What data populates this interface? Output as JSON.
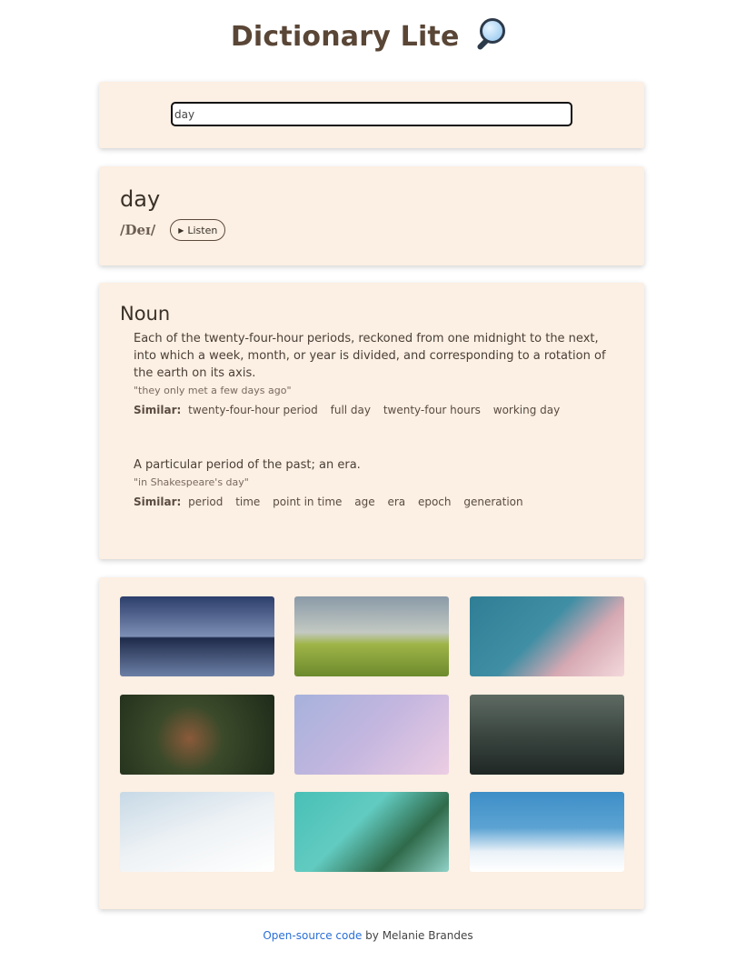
{
  "app": {
    "title": "Dictionary Lite"
  },
  "search": {
    "value": "day"
  },
  "word": {
    "text": "day",
    "phonetic": "/Deɪ/",
    "listen_label": "Listen"
  },
  "meaning": {
    "part_of_speech": "Noun",
    "similar_label": "Similar:",
    "definitions": [
      {
        "text": "Each of the twenty-four-hour periods, reckoned from one midnight to the next, into which a week, month, or year is divided, and corresponding to a rotation of the earth on its axis.",
        "example": "\"they only met a few days ago\"",
        "synonyms": [
          "twenty-four-hour period",
          "full day",
          "twenty-four hours",
          "working day"
        ]
      },
      {
        "text": "A particular period of the past; an era.",
        "example": "\"in Shakespeare's day\"",
        "synonyms": [
          "period",
          "time",
          "point in time",
          "age",
          "era",
          "epoch",
          "generation"
        ]
      }
    ]
  },
  "images": [
    {
      "name": "tree-reflection-image",
      "bg": "linear-gradient(#2c3e6b 0%, #7d8fb4 50%, #1f2a4a 52%, #6b7fa6 100%)"
    },
    {
      "name": "rainbow-field-image",
      "bg": "linear-gradient(#8a9aa8 0%, #c3c9c2 45%, #9fb447 60%, #6c8a2d 100%)"
    },
    {
      "name": "clouds-teal-image",
      "bg": "linear-gradient(135deg, #2f7e95 0%, #3f8ea4 45%, #d6a9b3 70%, #f3d8dc 100%)"
    },
    {
      "name": "child-leaves-image",
      "bg": "radial-gradient(circle at 45% 55%, #8a5a3a 0%, #3b4a2a 35%, #1e2b1a 100%)"
    },
    {
      "name": "pink-sky-image",
      "bg": "linear-gradient(135deg, #a6b2dc 0%, #c4b6df 50%, #eccde3 100%)"
    },
    {
      "name": "rainy-window-image",
      "bg": "linear-gradient(#5d6a62 0%, #3b4641 50%, #1f2724 100%)"
    },
    {
      "name": "white-clouds-image",
      "bg": "linear-gradient(160deg, #c7d9e6 0%, #eef2f5 50%, #ffffff 100%)"
    },
    {
      "name": "palm-leaves-image",
      "bg": "linear-gradient(135deg, #48c0b6 0%, #62cbc1 40%, #2f6a4a 70%, #8fd2c8 100%)"
    },
    {
      "name": "blue-sky-clouds-image",
      "bg": "linear-gradient(#3d8ec7 0%, #5ca3d3 45%, #eaf2f8 75%, #ffffff 100%)"
    }
  ],
  "footer": {
    "link_text": "Open-source code",
    "by_text": " by Melanie Brandes"
  }
}
